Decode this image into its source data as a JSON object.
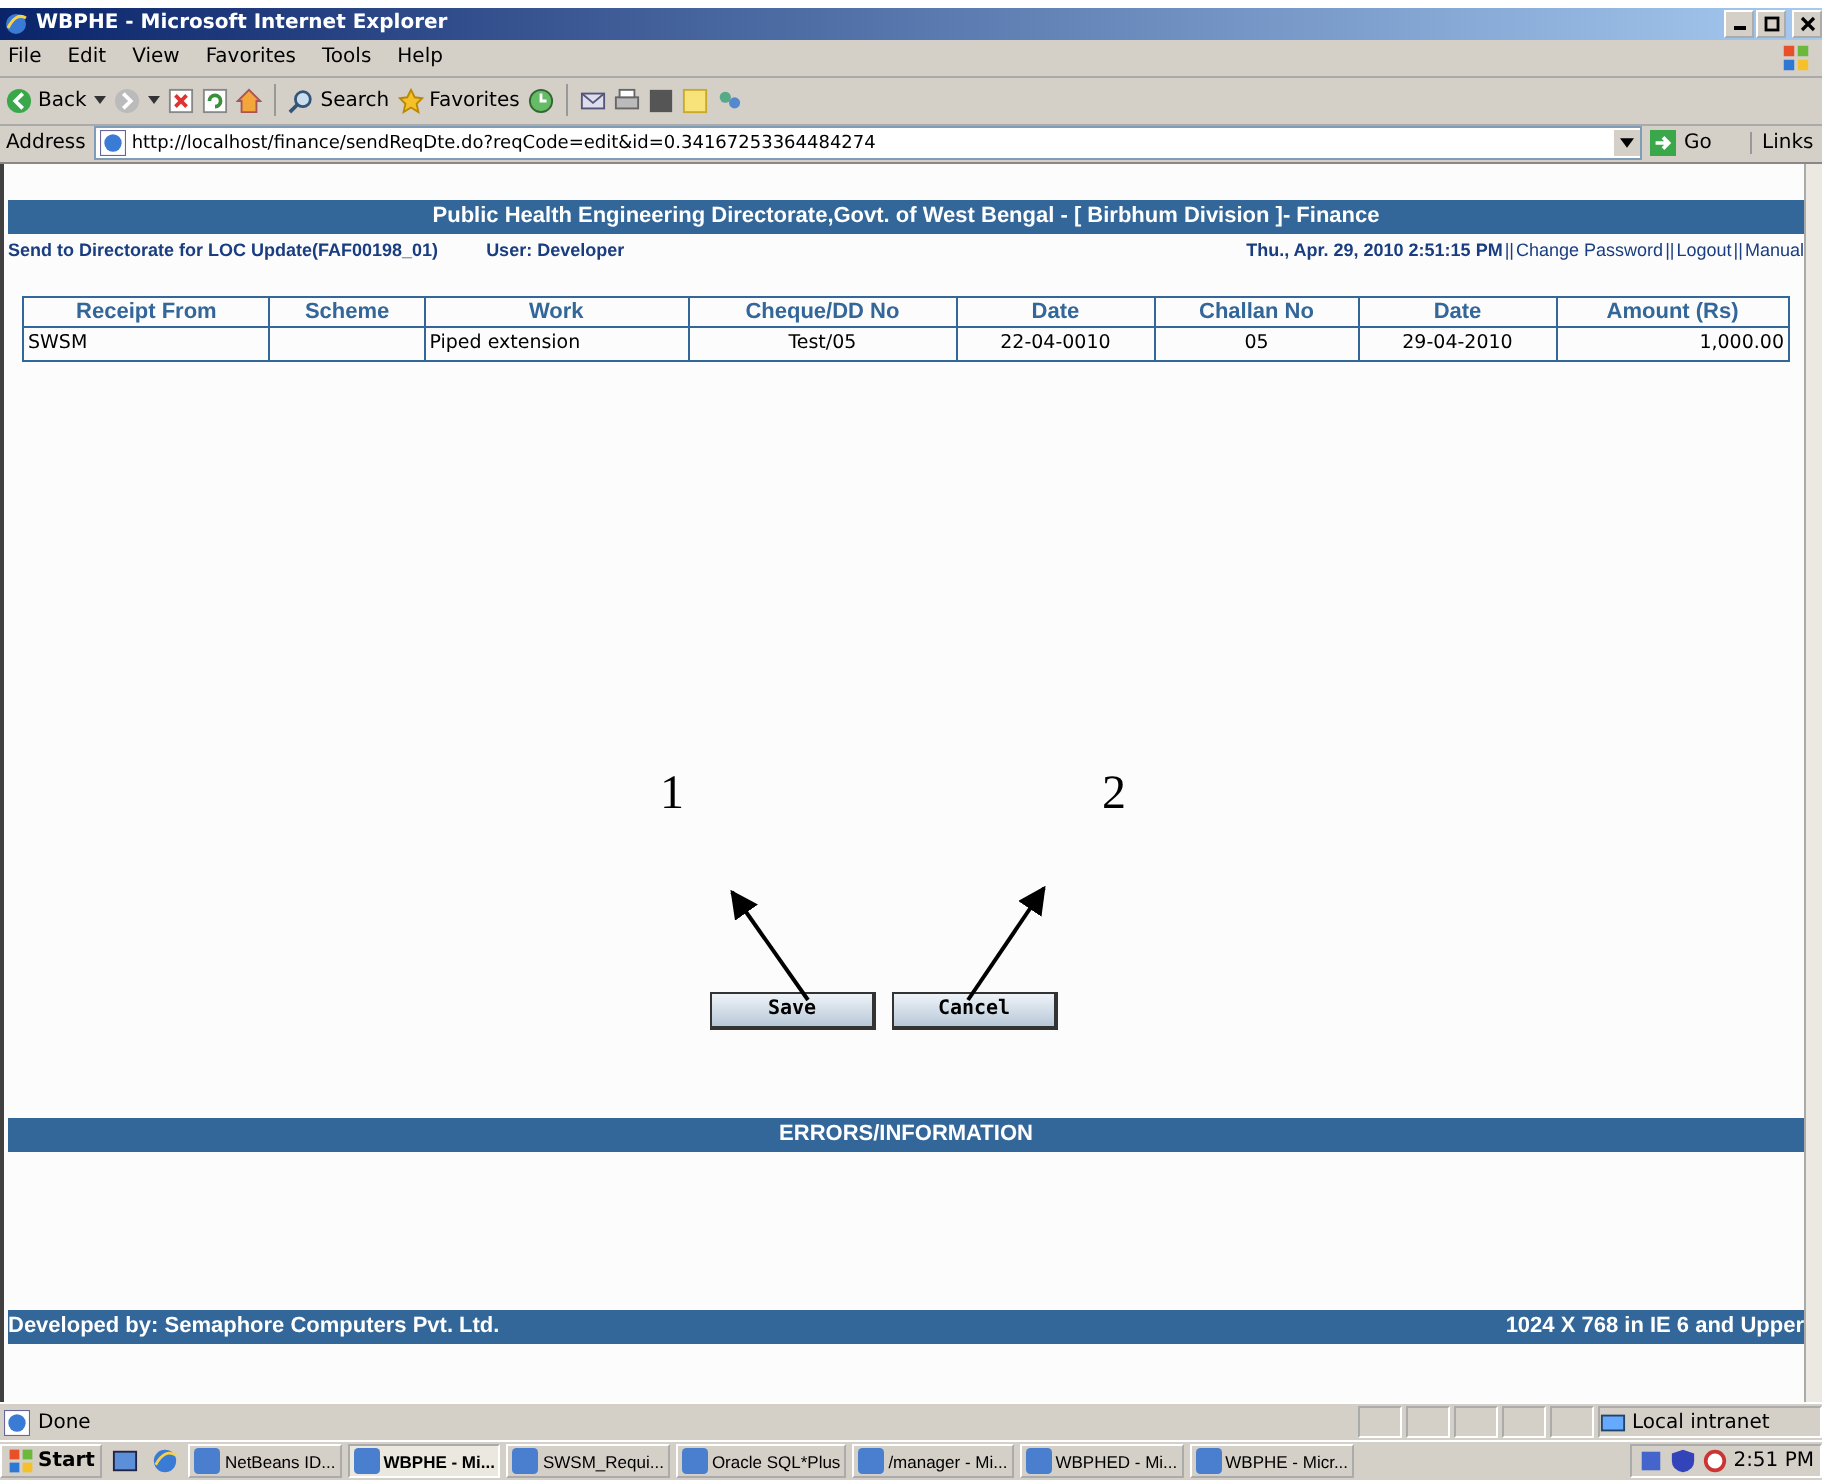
{
  "window": {
    "title": "WBPHE - Microsoft Internet Explorer"
  },
  "menu": [
    "File",
    "Edit",
    "View",
    "Favorites",
    "Tools",
    "Help"
  ],
  "toolbar": {
    "back": "Back",
    "search": "Search",
    "favorites": "Favorites"
  },
  "address": {
    "label": "Address",
    "url": "http://localhost/finance/sendReqDte.do?reqCode=edit&id=0.34167253364484274",
    "go": "Go",
    "links": "Links"
  },
  "page": {
    "header": "Public Health Engineering Directorate,Govt. of West Bengal - [ Birbhum Division ]- Finance",
    "form_title": "Send to Directorate for LOC Update(FAF00198_01)",
    "user": "User: Developer",
    "datetime": "Thu., Apr. 29, 2010 2:51:15 PM",
    "link_separator": "||",
    "links": [
      "Change Password",
      "Logout",
      "Manual"
    ],
    "table": {
      "columns": [
        "Receipt From",
        "Scheme",
        "Work",
        "Cheque/DD No",
        "Date",
        "Challan No",
        "Date",
        "Amount (Rs)"
      ],
      "rows": [
        [
          "SWSM",
          "",
          "Piped extension",
          "Test/05",
          "22-04-0010",
          "05",
          "29-04-2010",
          "1,000.00"
        ]
      ]
    },
    "buttons": [
      "Save",
      "Cancel"
    ],
    "annotations": [
      "1",
      "2"
    ],
    "errors_title": "ERRORS/INFORMATION",
    "footer_left": "Developed by: Semaphore Computers Pvt. Ltd.",
    "footer_right": "1024 X 768 in IE 6 and Upper"
  },
  "status_bar": {
    "text": "Done",
    "zone": "Local intranet"
  },
  "taskbar": {
    "start": "Start",
    "items": [
      {
        "label": "NetBeans ID...",
        "selected": false
      },
      {
        "label": "WBPHE - Mi...",
        "selected": true
      },
      {
        "label": "SWSM_Requi...",
        "selected": false
      },
      {
        "label": "Oracle SQL*Plus",
        "selected": false
      },
      {
        "label": "/manager - Mi...",
        "selected": false
      },
      {
        "label": "WBPHED - Mi...",
        "selected": false
      },
      {
        "label": "WBPHE - Micr...",
        "selected": false
      }
    ],
    "clock": "2:51 PM"
  }
}
